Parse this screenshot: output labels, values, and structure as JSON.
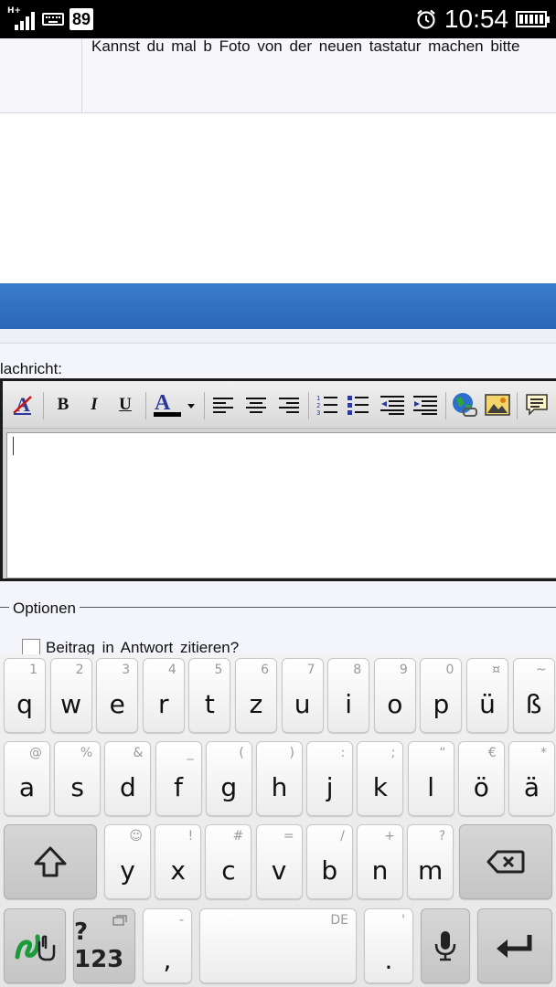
{
  "status_bar": {
    "network": "H+",
    "badge": "89",
    "time": "10:54"
  },
  "post": {
    "text": "Kannst du mal b Foto von der neuen tastatur machen bitte"
  },
  "compose": {
    "label": "lachricht:",
    "toolbar": {
      "bold": "B",
      "italic": "I",
      "underline": "U",
      "font_color": "A"
    }
  },
  "options": {
    "legend": "Optionen",
    "quote_label": "Beitrag in Antwort zitieren?"
  },
  "keyboard": {
    "row1": [
      {
        "main": "q",
        "hint": "1"
      },
      {
        "main": "w",
        "hint": "2"
      },
      {
        "main": "e",
        "hint": "3"
      },
      {
        "main": "r",
        "hint": "4"
      },
      {
        "main": "t",
        "hint": "5"
      },
      {
        "main": "z",
        "hint": "6"
      },
      {
        "main": "u",
        "hint": "7"
      },
      {
        "main": "i",
        "hint": "8"
      },
      {
        "main": "o",
        "hint": "9"
      },
      {
        "main": "p",
        "hint": "0"
      },
      {
        "main": "ü",
        "hint": "¤"
      },
      {
        "main": "ß",
        "hint": "~"
      }
    ],
    "row2": [
      {
        "main": "a",
        "hint": "@"
      },
      {
        "main": "s",
        "hint": "%"
      },
      {
        "main": "d",
        "hint": "&"
      },
      {
        "main": "f",
        "hint": "_"
      },
      {
        "main": "g",
        "hint": "("
      },
      {
        "main": "h",
        "hint": ")"
      },
      {
        "main": "j",
        "hint": ":"
      },
      {
        "main": "k",
        "hint": ";"
      },
      {
        "main": "l",
        "hint": "“"
      },
      {
        "main": "ö",
        "hint": "€"
      },
      {
        "main": "ä",
        "hint": "*"
      }
    ],
    "row3": [
      {
        "main": "y",
        "hint": "☺"
      },
      {
        "main": "x",
        "hint": "!"
      },
      {
        "main": "c",
        "hint": "#"
      },
      {
        "main": "v",
        "hint": "="
      },
      {
        "main": "b",
        "hint": "/"
      },
      {
        "main": "n",
        "hint": "+"
      },
      {
        "main": "m",
        "hint": "?"
      }
    ],
    "symbols_key": "?123",
    "comma": {
      "main": ",",
      "hint": "-"
    },
    "space_hint": "DE",
    "period": {
      "main": ".",
      "hint": "'"
    },
    "colors": {
      "key_light": "#ffffff",
      "key_dark": "#c8c8c8",
      "swype_green": "#1a9a3a"
    }
  }
}
